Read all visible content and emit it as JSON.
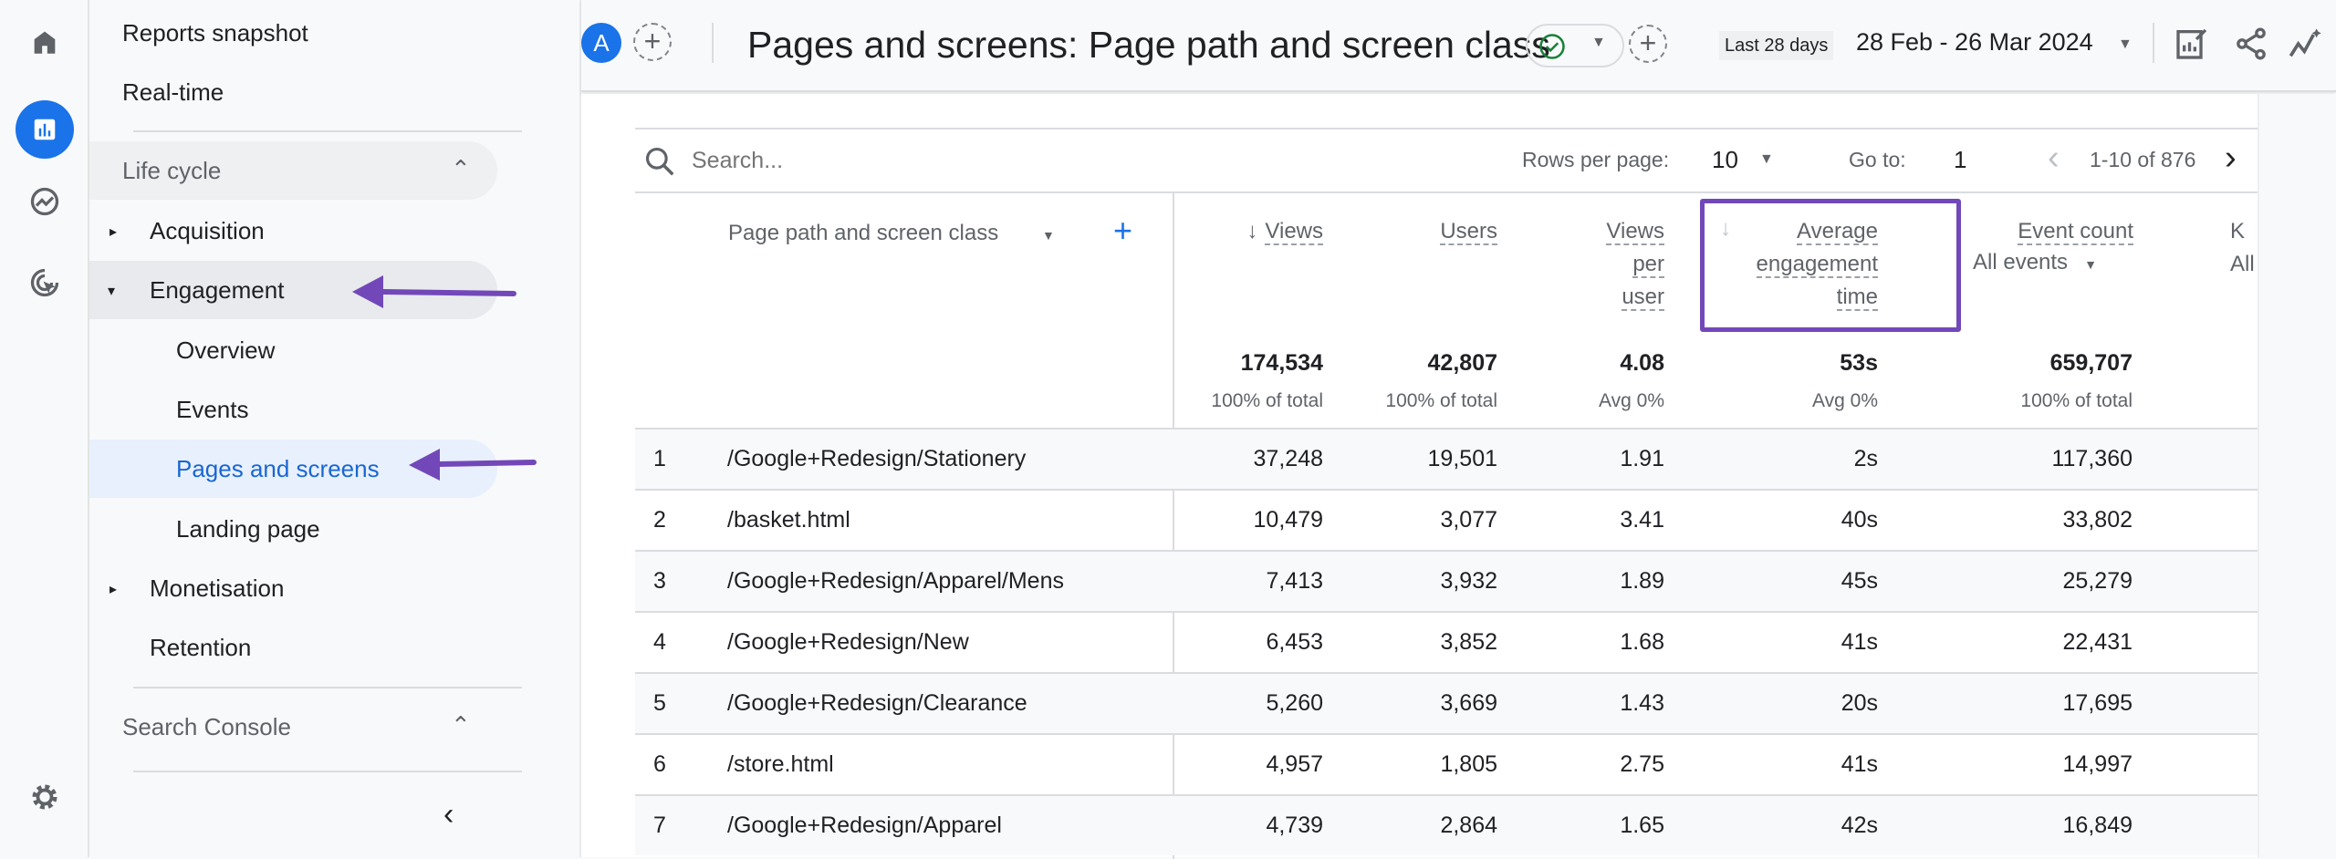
{
  "rail": {
    "icons": [
      "home-icon",
      "reports-icon",
      "explore-icon",
      "advertising-icon",
      "settings-icon"
    ]
  },
  "sidebar": {
    "reports_snapshot": "Reports snapshot",
    "realtime": "Real-time",
    "lifecycle": "Life cycle",
    "acquisition": "Acquisition",
    "engagement": "Engagement",
    "overview": "Overview",
    "events": "Events",
    "pages_and_screens": "Pages and screens",
    "landing_page": "Landing page",
    "monetisation": "Monetisation",
    "retention": "Retention",
    "search_console": "Search Console"
  },
  "header": {
    "avatar": "A",
    "title": "Pages and screens: Page path and screen class",
    "date_label": "Last 28 days",
    "date_range": "28 Feb - 26 Mar 2024"
  },
  "toolbar": {
    "search_placeholder": "Search...",
    "rows_per_page_label": "Rows per page:",
    "rows_per_page": "10",
    "goto_label": "Go to:",
    "goto_value": "1",
    "pagination": "1-10 of 876"
  },
  "columns": {
    "dimension": "Page path and screen class",
    "views": "Views",
    "users": "Users",
    "vpu": [
      "Views",
      "per",
      "user"
    ],
    "aet": [
      "Average",
      "engagement",
      "time"
    ],
    "event_count": "Event count",
    "event_filter": "All events",
    "partial": [
      "K",
      "All"
    ]
  },
  "totals": {
    "views": "174,534",
    "views_sub": "100% of total",
    "users": "42,807",
    "users_sub": "100% of total",
    "vpu": "4.08",
    "vpu_sub": "Avg 0%",
    "aet": "53s",
    "aet_sub": "Avg 0%",
    "events": "659,707",
    "events_sub": "100% of total"
  },
  "rows": [
    {
      "i": "1",
      "path": "/Google+Redesign/Stationery",
      "views": "37,248",
      "users": "19,501",
      "vpu": "1.91",
      "aet": "2s",
      "events": "117,360"
    },
    {
      "i": "2",
      "path": "/basket.html",
      "views": "10,479",
      "users": "3,077",
      "vpu": "3.41",
      "aet": "40s",
      "events": "33,802"
    },
    {
      "i": "3",
      "path": "/Google+Redesign/Apparel/Mens",
      "views": "7,413",
      "users": "3,932",
      "vpu": "1.89",
      "aet": "45s",
      "events": "25,279"
    },
    {
      "i": "4",
      "path": "/Google+Redesign/New",
      "views": "6,453",
      "users": "3,852",
      "vpu": "1.68",
      "aet": "41s",
      "events": "22,431"
    },
    {
      "i": "5",
      "path": "/Google+Redesign/Clearance",
      "views": "5,260",
      "users": "3,669",
      "vpu": "1.43",
      "aet": "20s",
      "events": "17,695"
    },
    {
      "i": "6",
      "path": "/store.html",
      "views": "4,957",
      "users": "1,805",
      "vpu": "2.75",
      "aet": "41s",
      "events": "14,997"
    },
    {
      "i": "7",
      "path": "/Google+Redesign/Apparel",
      "views": "4,739",
      "users": "2,864",
      "vpu": "1.65",
      "aet": "42s",
      "events": "16,849"
    }
  ],
  "colors": {
    "accent": "#1a73e8",
    "annotation": "#7248b9",
    "active_nav": "#e8f0fe"
  }
}
